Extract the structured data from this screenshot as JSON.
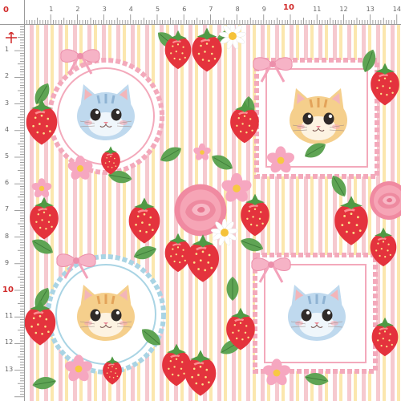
{
  "ruler": {
    "unit": "cm",
    "origin_label": "0",
    "top_labels": [
      "1",
      "2",
      "3",
      "4",
      "5",
      "6",
      "7",
      "8",
      "9",
      "10",
      "11",
      "12",
      "13",
      "14"
    ],
    "left_labels": [
      "1",
      "2",
      "3",
      "4",
      "5",
      "6",
      "7",
      "8",
      "9",
      "10",
      "11",
      "12",
      "13"
    ],
    "highlight_label": "10"
  },
  "pattern": {
    "stripe_colors": [
      "#f6c9cf",
      "#fbe7ae",
      "#ffffff"
    ],
    "frame_colors": {
      "pink": "#f3a9bb",
      "blue": "#a9d4e4"
    },
    "cats": [
      {
        "name": "blue-tabby-cat",
        "frame": "circle",
        "fur": "#bfd9ee"
      },
      {
        "name": "orange-tabby-cat",
        "frame": "square",
        "fur": "#f5cf8c"
      },
      {
        "name": "orange-tabby-cat",
        "frame": "circle",
        "fur": "#f5cf8c"
      },
      {
        "name": "blue-tabby-cat",
        "frame": "square",
        "fur": "#bfd9ee"
      }
    ],
    "motifs": [
      "strawberry",
      "pink-rose",
      "pink-blossom",
      "daisy",
      "green-leaf",
      "pink-bow"
    ]
  }
}
